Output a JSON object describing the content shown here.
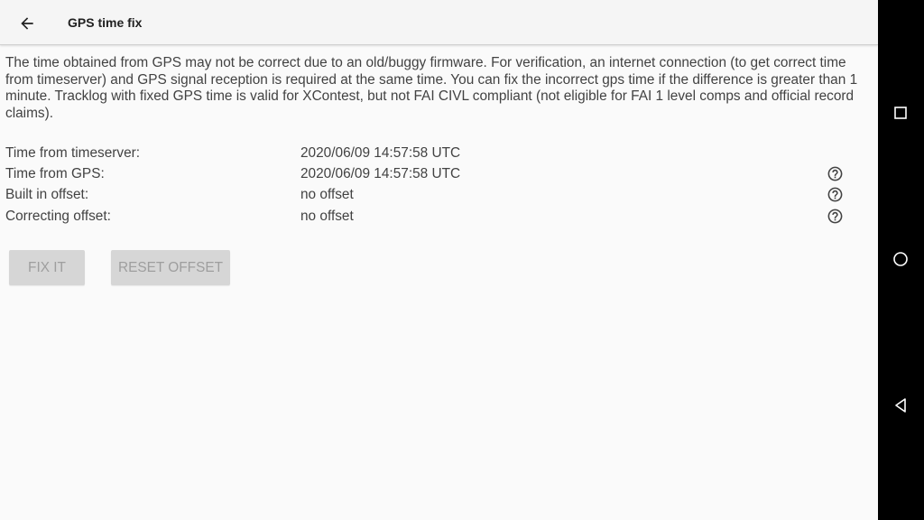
{
  "appbar": {
    "title": "GPS time fix",
    "back_icon": "arrow-left-icon"
  },
  "description": "The time obtained from GPS may not be correct due to an old/buggy firmware. For verification, an internet connection (to get correct time from timeserver) and GPS signal reception is required at the same time. You can fix the incorrect gps time if the difference is greater than 1 minute. Tracklog with fixed GPS time is valid for XContest, but not FAI CIVL compliant (not eligible for FAI 1 level comps and official record claims).",
  "info": {
    "timeserver": {
      "label": "Time from timeserver:",
      "value": "2020/06/09 14:57:58 UTC"
    },
    "gps": {
      "label": "Time from GPS:",
      "value": "2020/06/09 14:57:58 UTC",
      "icon": "help-circle-icon"
    },
    "builtin_offset": {
      "label": "Built in offset:",
      "value": "no offset",
      "icon": "help-circle-icon"
    },
    "correcting_offset": {
      "label": "Correcting offset:",
      "value": "no offset",
      "icon": "help-circle-icon"
    }
  },
  "buttons": {
    "fix_label": "FIX IT",
    "reset_label": "RESET OFFSET",
    "enabled": false
  },
  "navbar": {
    "icons": [
      "recents-square-icon",
      "home-circle-icon",
      "back-triangle-icon"
    ]
  },
  "colors": {
    "background": "#fafafa",
    "appbar": "#f5f5f5",
    "text": "#424242",
    "title": "#212121",
    "button_bg": "#d6d6d6",
    "button_text": "#9e9e9e",
    "navbar": "#000000"
  }
}
